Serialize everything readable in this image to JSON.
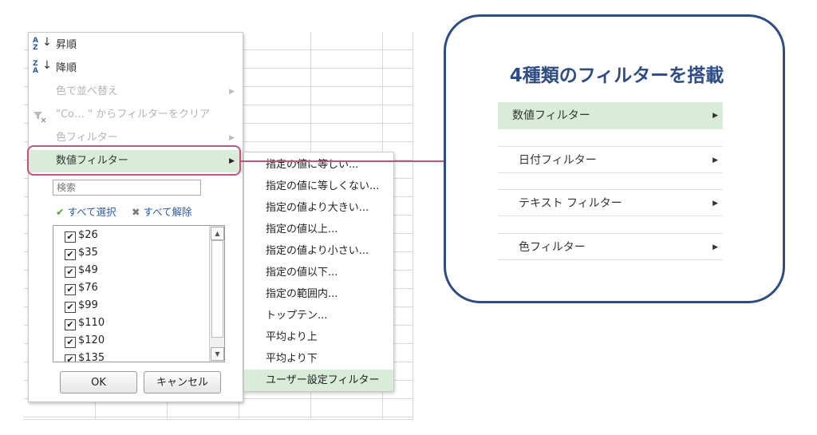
{
  "menu": {
    "sort_asc": "昇順",
    "sort_asc_icon_top": "A",
    "sort_asc_icon_bottom": "Z",
    "sort_desc": "降順",
    "sort_desc_icon_top": "Z",
    "sort_desc_icon_bottom": "A",
    "sort_arrow": "↓",
    "sort_by_color": "色で並べ替え",
    "clear_filter": "\"Co…  \" からフィルターをクリア",
    "color_filter": "色フィルター",
    "number_filter": "数値フィルター",
    "submenu_arrow": "▶"
  },
  "search": {
    "placeholder": "検索"
  },
  "select_all": {
    "check": "✔",
    "label": "すべて選択"
  },
  "clear_all": {
    "x": "✖",
    "label": "すべて解除"
  },
  "values": [
    {
      "label": "$26",
      "checked": "✔"
    },
    {
      "label": "$35",
      "checked": "✔"
    },
    {
      "label": "$49",
      "checked": "✔"
    },
    {
      "label": "$76",
      "checked": "✔"
    },
    {
      "label": "$99",
      "checked": "✔"
    },
    {
      "label": "$110",
      "checked": "✔"
    },
    {
      "label": "$120",
      "checked": "✔"
    },
    {
      "label": "$135",
      "checked": "✔"
    }
  ],
  "buttons": {
    "ok": "OK",
    "cancel": "キャンセル"
  },
  "submenu": [
    "指定の値に等しい...",
    "指定の値に等しくない...",
    "指定の値より大きい...",
    "指定の値以上...",
    "指定の値より小さい...",
    "指定の値以下...",
    "指定の範囲内...",
    "トップテン...",
    "平均より上",
    "平均より下",
    "ユーザー設定フィルター"
  ],
  "callout": {
    "title": "4種類のフィルターを搭載",
    "filters": [
      "数値フィルター",
      "日付フィルター",
      "テキスト フィルター",
      "色フィルター"
    ],
    "arrow": "▶"
  },
  "colors": {
    "accent_pink": "#c7507c",
    "navy": "#2d4c86",
    "highlight_green": "#d8ecd9"
  }
}
